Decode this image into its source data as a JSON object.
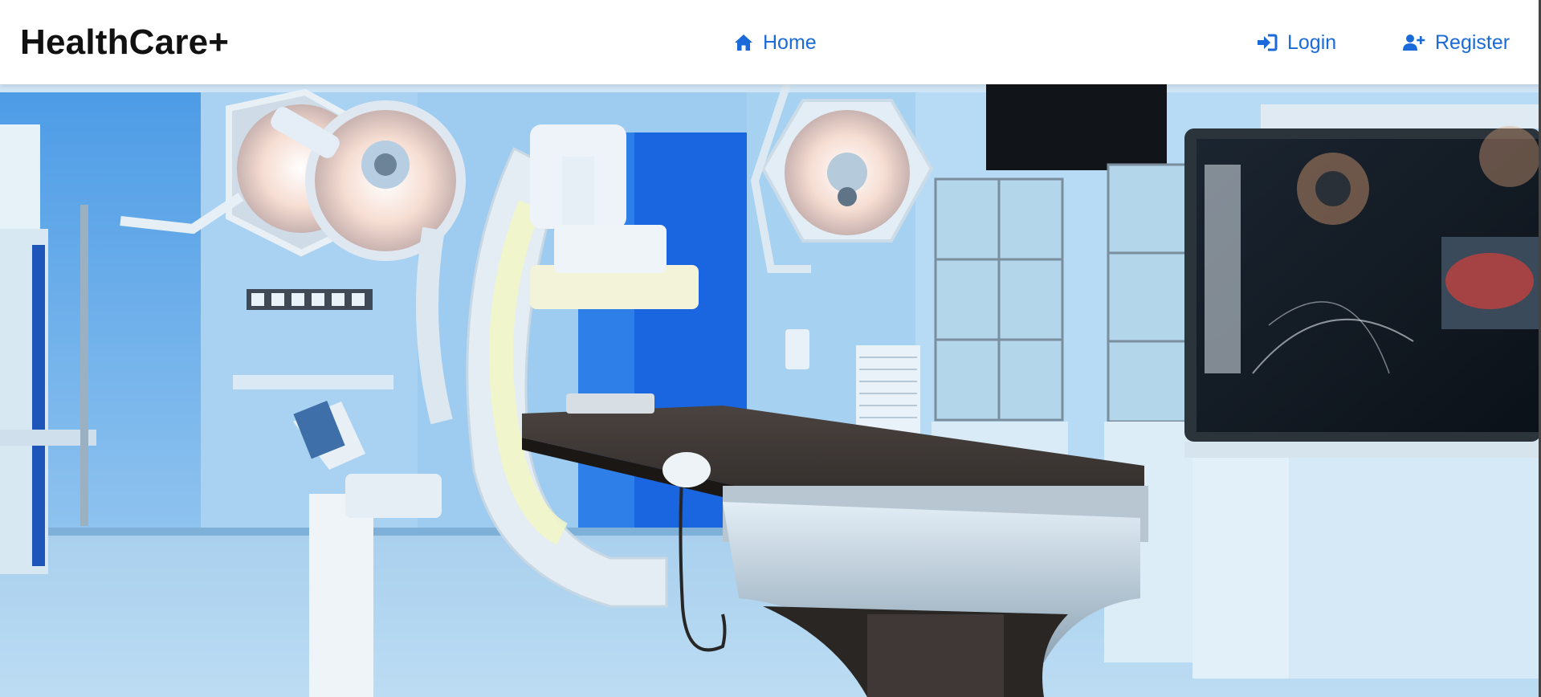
{
  "navbar": {
    "brand": "HealthCare+",
    "links": {
      "home": "Home",
      "login": "Login",
      "register": "Register"
    }
  },
  "colors": {
    "accent": "#1a6ad9",
    "brand_text": "#111111",
    "navbar_bg": "#ffffff"
  },
  "icons": {
    "home": "home-icon",
    "login": "sign-in-icon",
    "register": "user-plus-icon"
  },
  "hero": {
    "image": "hospital-operating-room-photo"
  }
}
